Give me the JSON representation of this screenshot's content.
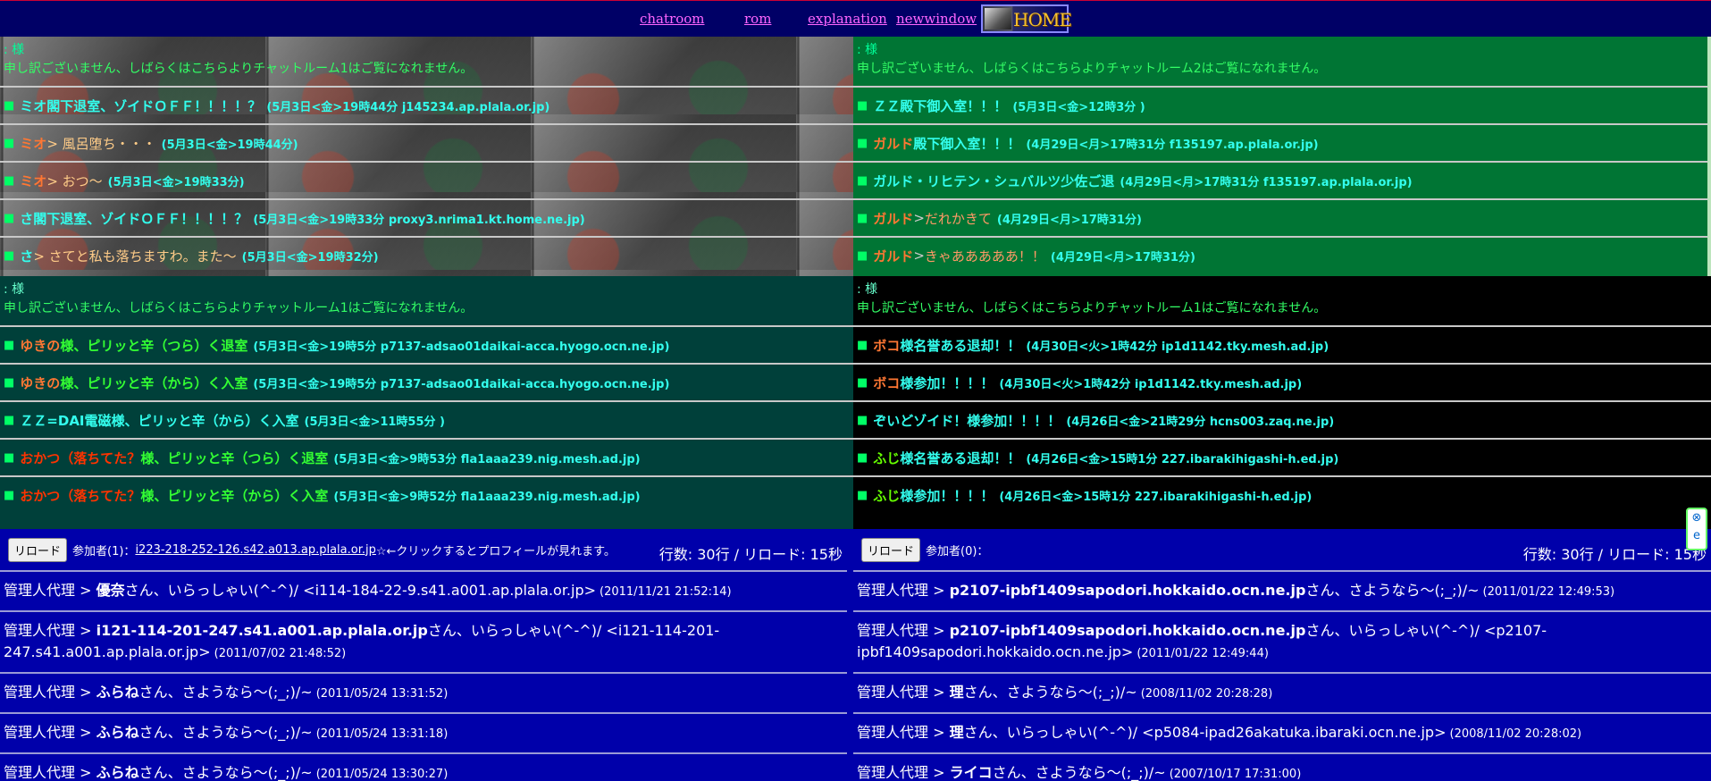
{
  "nav": {
    "links": [
      "chatroom",
      "rom",
      "explanation",
      "newwindow"
    ],
    "home_label": "HOME"
  },
  "rooms": [
    {
      "head": ": 様",
      "message": "申し訳ございません、しばらくはこちらよりチャットルーム1はご覧になれません。",
      "rows": [
        {
          "parts": [
            [
              "ミオ閣下退室、ゾイドＯＦＦ！！！！？",
              "c-cyan"
            ]
          ],
          "info": "(5月3日<金>19時44分 j145234.ap.plala.or.jp)"
        },
        {
          "parts": [
            [
              "ミオ",
              "c-orange"
            ],
            [
              " > 風呂堕ち・・・",
              "c-tan"
            ]
          ],
          "info": "(5月3日<金>19時44分)"
        },
        {
          "parts": [
            [
              "ミオ",
              "c-orange"
            ],
            [
              " > おつ～",
              "c-tan"
            ]
          ],
          "info": "(5月3日<金>19時33分)"
        },
        {
          "parts": [
            [
              "さ閣下退室、ゾイドＯＦＦ！！！！？",
              "c-cyan"
            ]
          ],
          "info": "(5月3日<金>19時33分 proxy3.nrima1.kt.home.ne.jp)"
        },
        {
          "parts": [
            [
              "さ",
              "c-cyan"
            ],
            [
              " > さてと私も落ちますわ。また～",
              "c-tan"
            ]
          ],
          "info": "(5月3日<金>19時32分)"
        }
      ]
    },
    {
      "head": ": 様",
      "message": "申し訳ございません、しばらくはこちらよりチャットルーム2はご覧になれません。",
      "rows": [
        {
          "parts": [
            [
              "ＺＺ殿下御入室！！！",
              "c-cyan"
            ]
          ],
          "info": "(5月3日<金>12時3分 )"
        },
        {
          "parts": [
            [
              "ガルド",
              "c-orange"
            ],
            [
              "殿下御入室！！！",
              "c-cyan"
            ]
          ],
          "info": "(4月29日<月>17時31分 f135197.ap.plala.or.jp)"
        },
        {
          "parts": [
            [
              "ガルド・リヒテン・シュバルツ少佐ご退",
              "c-cyan"
            ]
          ],
          "info": "(4月29日<月>17時31分 f135197.ap.plala.or.jp)"
        },
        {
          "parts": [
            [
              "ガルド",
              "c-orange"
            ],
            [
              " > ",
              "c-gray"
            ],
            [
              "だれかきて",
              "c-salmon"
            ]
          ],
          "info": "(4月29日<月>17時31分)"
        },
        {
          "parts": [
            [
              "ガルド",
              "c-orange"
            ],
            [
              " > ",
              "c-gray"
            ],
            [
              "きゃあああああ！！",
              "c-salmon"
            ]
          ],
          "info": "(4月29日<月>17時31分)"
        }
      ]
    },
    {
      "head": ": 様",
      "message": "申し訳ございません、しばらくはこちらよりチャットルーム1はご覧になれません。",
      "rows": [
        {
          "parts": [
            [
              "ゆきの",
              "c-orange"
            ],
            [
              "様、ピリッと辛（つら）く退室",
              "c-green"
            ]
          ],
          "info": "(5月3日<金>19時5分 p7137-adsao01daikai-acca.hyogo.ocn.ne.jp)"
        },
        {
          "parts": [
            [
              "ゆきの",
              "c-orange"
            ],
            [
              "様、ピリッと辛（から）く入室",
              "c-green"
            ]
          ],
          "info": "(5月3日<金>19時5分 p7137-adsao01daikai-acca.hyogo.ocn.ne.jp)"
        },
        {
          "parts": [
            [
              "ＺＺ=DAI電磁様、ピリッと辛（から）く入室",
              "c-cyan"
            ]
          ],
          "info": "(5月3日<金>11時55分 )"
        },
        {
          "parts": [
            [
              "おかつ（落ちてた？",
              "c-red"
            ],
            [
              "様、ピリッと辛（つら）く退室",
              "c-green"
            ]
          ],
          "info": "(5月3日<金>9時53分 fla1aaa239.nig.mesh.ad.jp)"
        },
        {
          "parts": [
            [
              "おかつ（落ちてた？",
              "c-red"
            ],
            [
              "様、ピリッと辛（から）く入室",
              "c-green"
            ]
          ],
          "info": "(5月3日<金>9時52分 fla1aaa239.nig.mesh.ad.jp)"
        }
      ]
    },
    {
      "head": ": 様",
      "message": "申し訳ございません、しばらくはこちらよりチャットルーム1はご覧になれません。",
      "rows": [
        {
          "parts": [
            [
              "ボコ",
              "c-orange"
            ],
            [
              "様名誉ある退却！！",
              "c-cyan"
            ]
          ],
          "info": "(4月30日<火>1時42分 ip1d1142.tky.mesh.ad.jp)"
        },
        {
          "parts": [
            [
              "ボコ",
              "c-orange"
            ],
            [
              "様参加！！！！",
              "c-cyan"
            ]
          ],
          "info": "(4月30日<火>1時42分 ip1d1142.tky.mesh.ad.jp)"
        },
        {
          "parts": [
            [
              "ぞいどゾイド！様参加！！！！",
              "c-cyan"
            ]
          ],
          "info": "(4月26日<金>21時29分 hcns003.zaq.ne.jp)"
        },
        {
          "parts": [
            [
              "ふじ",
              "c-lime"
            ],
            [
              "様名誉ある退却！！",
              "c-cyan"
            ]
          ],
          "info": "(4月26日<金>15時1分 227.ibarakihigashi-h.ed.jp)"
        },
        {
          "parts": [
            [
              "ふじ",
              "c-lime"
            ],
            [
              "様参加！！！！",
              "c-cyan"
            ]
          ],
          "info": "(4月26日<金>15時1分 227.ibarakihigashi-h.ed.jp)"
        }
      ]
    }
  ],
  "logs": [
    {
      "reload": "リロード",
      "participants_prefix": "参加者(1)：",
      "participant_link": "i223-218-252-126.s42.a013.ap.plala.or.jp",
      "participants_suffix": "☆←クリックするとプロフィールが見れます。",
      "stat": "行数: 30行 / リロード: 15秒",
      "entries": [
        {
          "pre": "管理人代理 > ",
          "name": "優奈",
          "post": "さん、いらっしゃい(^-^)/ <i114-184-22-9.s41.a001.ap.plala.or.jp>",
          "ts": "(2011/11/21 21:52:14)"
        },
        {
          "pre": "管理人代理 > ",
          "name": "i121-114-201-247.s41.a001.ap.plala.or.jp",
          "post": "さん、いらっしゃい(^-^)/ <i121-114-201-247.s41.a001.ap.plala.or.jp>",
          "ts": "(2011/07/02 21:48:52)"
        },
        {
          "pre": "管理人代理 > ",
          "name": "ふらね",
          "post": "さん、さようなら～(;_;)/~",
          "ts": "(2011/05/24 13:31:52)"
        },
        {
          "pre": "管理人代理 > ",
          "name": "ふらね",
          "post": "さん、さようなら～(;_;)/~",
          "ts": "(2011/05/24 13:31:18)"
        },
        {
          "pre": "管理人代理 > ",
          "name": "ふらね",
          "post": "さん、さようなら～(;_;)/~",
          "ts": "(2011/05/24 13:30:27)"
        }
      ]
    },
    {
      "reload": "リロード",
      "participants_prefix": "参加者(0)：",
      "participant_link": "",
      "participants_suffix": "",
      "stat": "行数: 30行 / リロード: 15秒",
      "entries": [
        {
          "pre": "管理人代理 > ",
          "name": "p2107-ipbf1409sapodori.hokkaido.ocn.ne.jp",
          "post": "さん、さようなら～(;_;)/~",
          "ts": "(2011/01/22 12:49:53)"
        },
        {
          "pre": "管理人代理 > ",
          "name": "p2107-ipbf1409sapodori.hokkaido.ocn.ne.jp",
          "post": "さん、いらっしゃい(^-^)/ <p2107-ipbf1409sapodori.hokkaido.ocn.ne.jp>",
          "ts": "(2011/01/22 12:49:44)"
        },
        {
          "pre": "管理人代理 > ",
          "name": "理",
          "post": "さん、さようなら～(;_;)/~",
          "ts": "(2008/11/02 20:28:28)"
        },
        {
          "pre": "管理人代理 > ",
          "name": "理",
          "post": "さん、いらっしゃい(^-^)/ <p5084-ipad26akatuka.ibaraki.ocn.ne.jp>",
          "ts": "(2008/11/02 20:28:02)"
        },
        {
          "pre": "管理人代理 > ",
          "name": "ライコ",
          "post": "さん、さようなら～(;_;)/~",
          "ts": "(2007/10/17 17:31:00)"
        }
      ]
    }
  ],
  "side_widget": {
    "close": "⊗",
    "e": "e"
  },
  "colors": {
    "nav_bg": "#000066",
    "room2_bg": "#007534",
    "room3_bg": "#00403a",
    "log_bg": "#0000aa",
    "link": "#ff66ff"
  }
}
